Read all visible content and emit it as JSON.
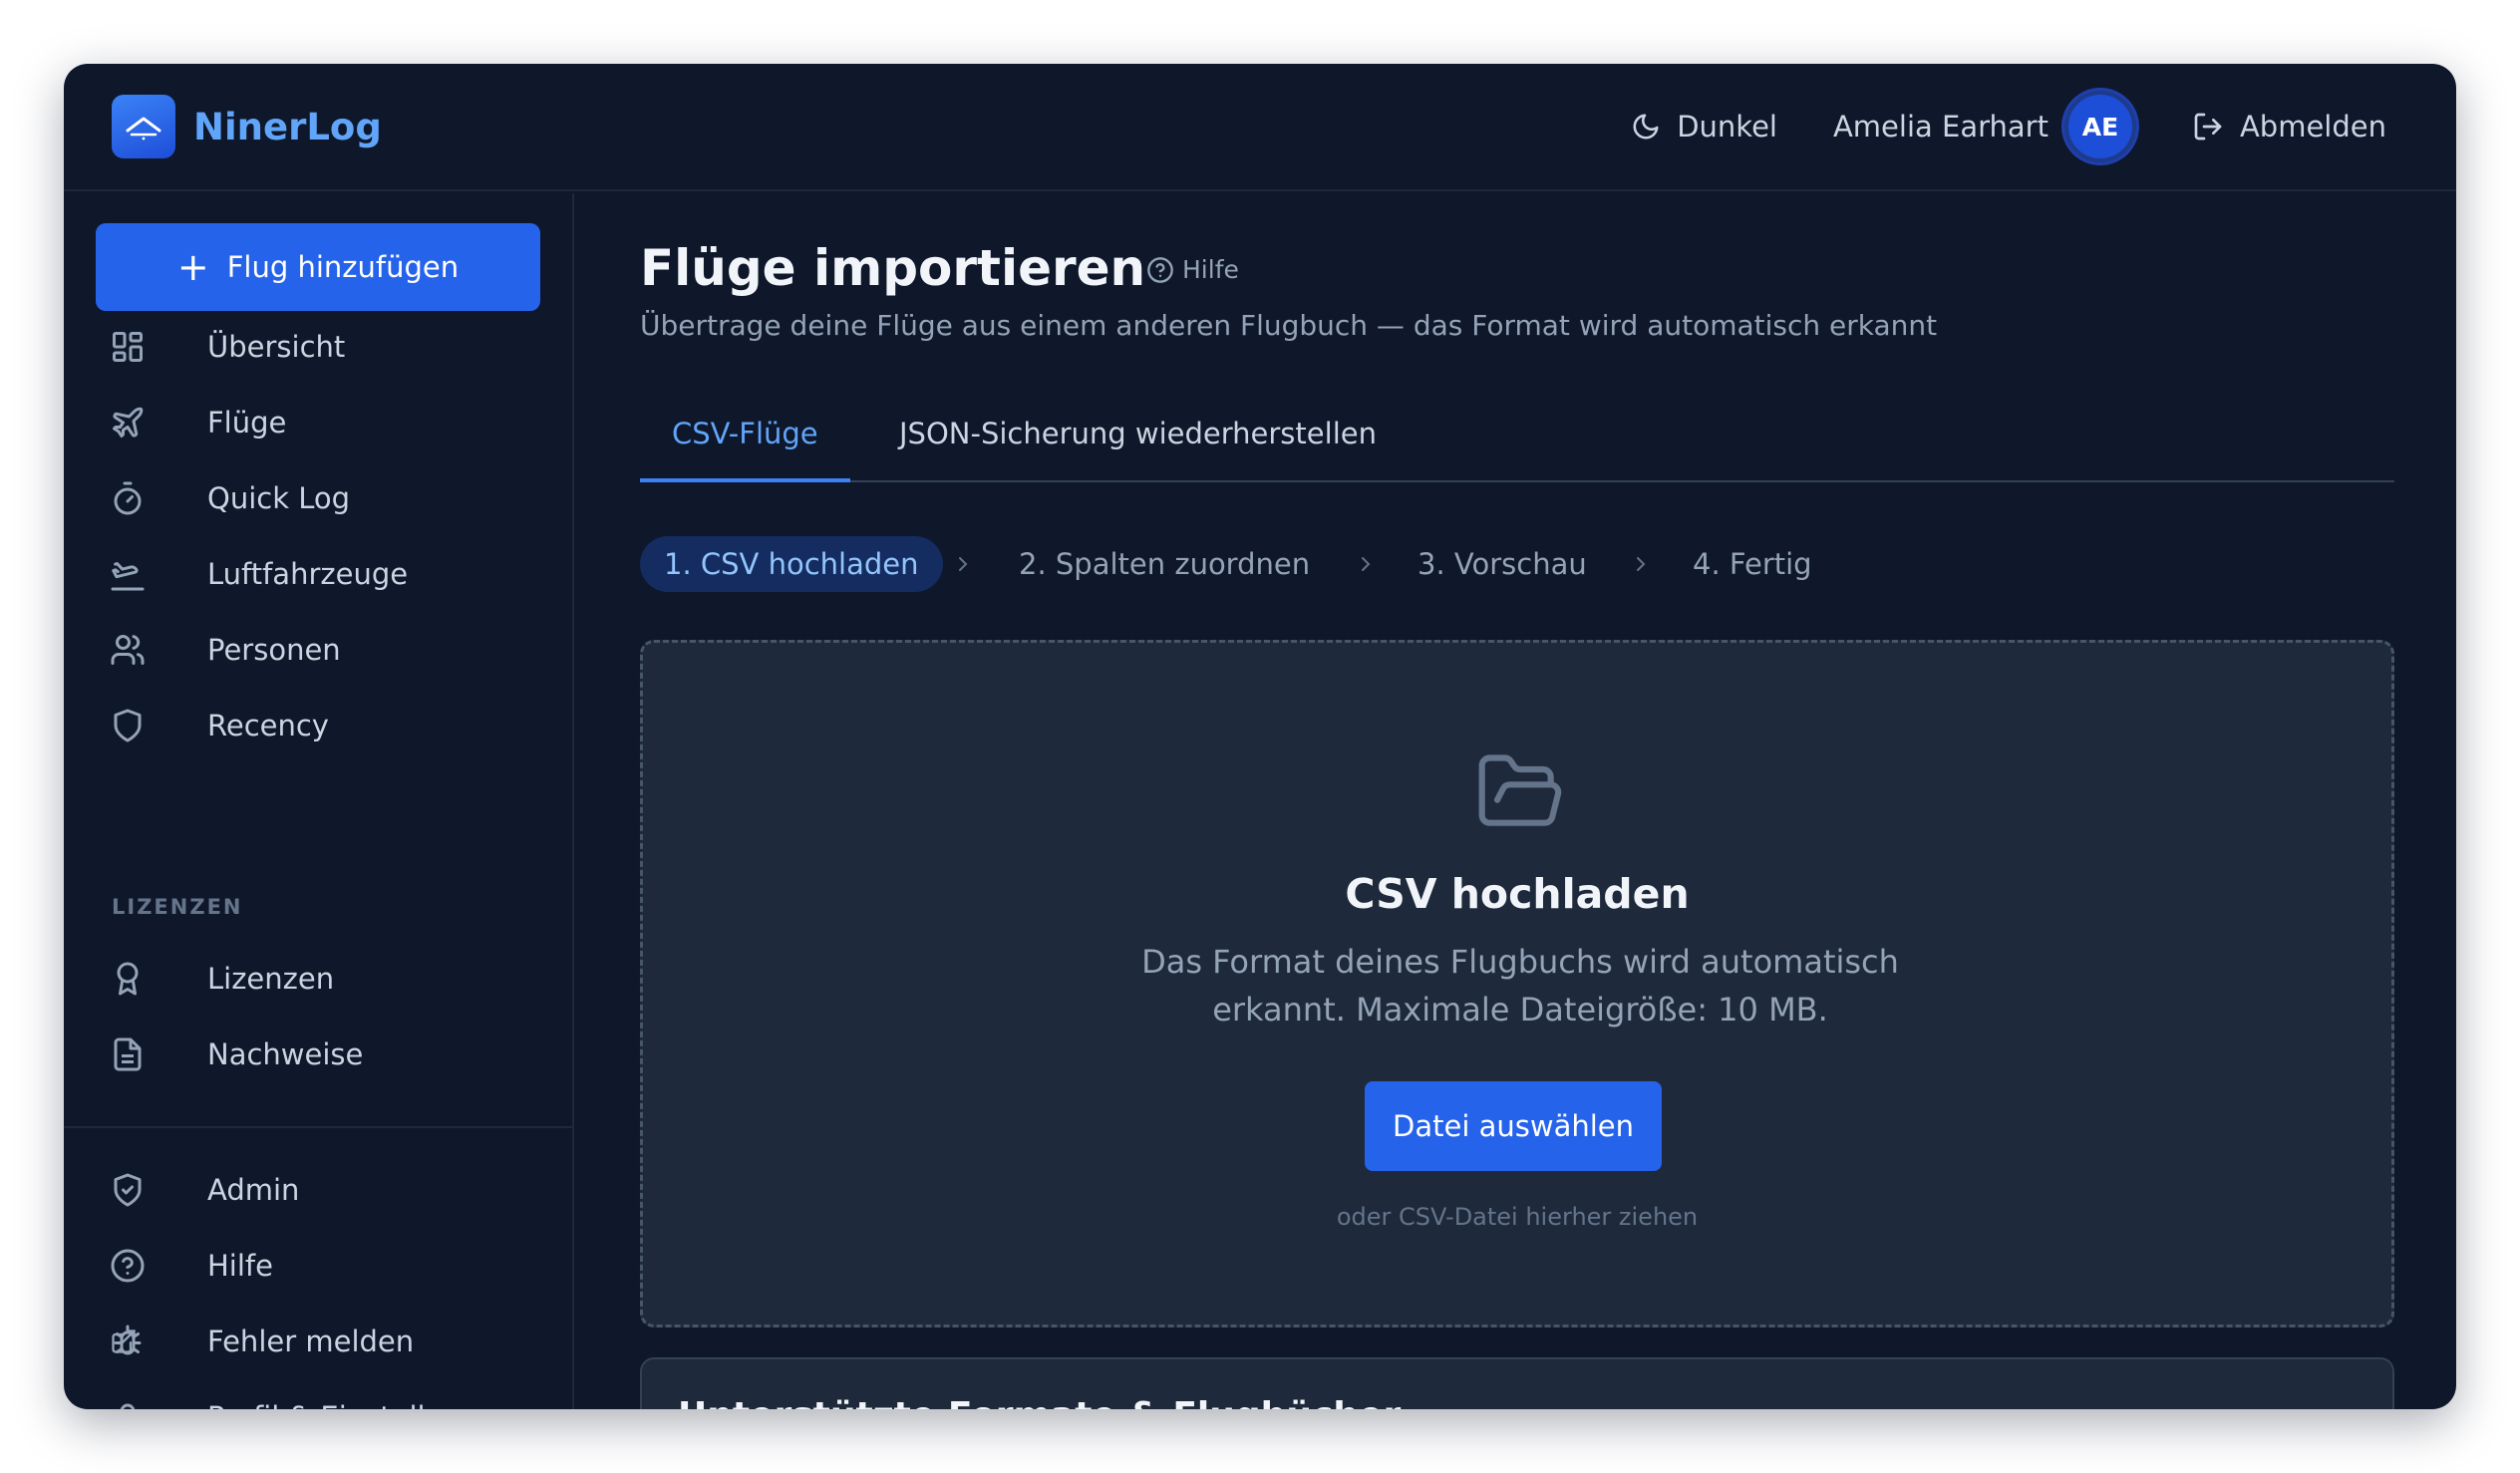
{
  "app": {
    "name": "NinerLog"
  },
  "topbar": {
    "theme_label": "Dunkel",
    "user_name": "Amelia Earhart",
    "user_initials": "AE",
    "logout_label": "Abmelden"
  },
  "sidebar": {
    "add_flight_label": "Flug hinzufügen",
    "items": [
      {
        "label": "Übersicht",
        "icon": "dashboard-icon"
      },
      {
        "label": "Flüge",
        "icon": "plane-icon"
      },
      {
        "label": "Quick Log",
        "icon": "stopwatch-icon"
      },
      {
        "label": "Luftfahrzeuge",
        "icon": "plane-landing-icon"
      },
      {
        "label": "Personen",
        "icon": "users-icon"
      },
      {
        "label": "Recency",
        "icon": "shield-icon"
      }
    ],
    "section_title": "LIZENZEN",
    "license_items": [
      {
        "label": "Lizenzen",
        "icon": "award-icon"
      },
      {
        "label": "Nachweise",
        "icon": "document-icon"
      }
    ],
    "bottom_items": [
      {
        "label": "Admin",
        "icon": "shield-check-icon"
      },
      {
        "label": "Hilfe",
        "icon": "help-circle-icon"
      },
      {
        "label": "Fehler melden",
        "icon": "bug-icon"
      },
      {
        "label": "Profil & Einstellungen",
        "icon": "user-icon"
      }
    ]
  },
  "main": {
    "title": "Flüge importieren",
    "help_label": "Hilfe",
    "subtitle": "Übertrage deine Flüge aus einem anderen Flugbuch — das Format wird automatisch erkannt",
    "tabs": [
      {
        "label": "CSV-Flüge",
        "active": true
      },
      {
        "label": "JSON-Sicherung wiederherstellen",
        "active": false
      }
    ],
    "steps": [
      {
        "label": "1. CSV hochladen",
        "active": true
      },
      {
        "label": "2. Spalten zuordnen",
        "active": false
      },
      {
        "label": "3. Vorschau",
        "active": false
      },
      {
        "label": "4. Fertig",
        "active": false
      }
    ],
    "dropzone": {
      "icon": "folder-open-icon",
      "title": "CSV hochladen",
      "description": "Das Format deines Flugbuchs wird automatisch erkannt. Maximale Dateigröße: 10 MB.",
      "button_label": "Datei auswählen",
      "hint": "oder CSV-Datei hierher ziehen"
    },
    "next_card_title": "Unterstützte Formate & Flugbücher"
  },
  "colors": {
    "background": "#0f172a",
    "surface": "#1e293b",
    "accent": "#2563eb",
    "accent_text": "#60a5fa",
    "text": "#cbd5e1",
    "muted": "#94a3b8"
  }
}
